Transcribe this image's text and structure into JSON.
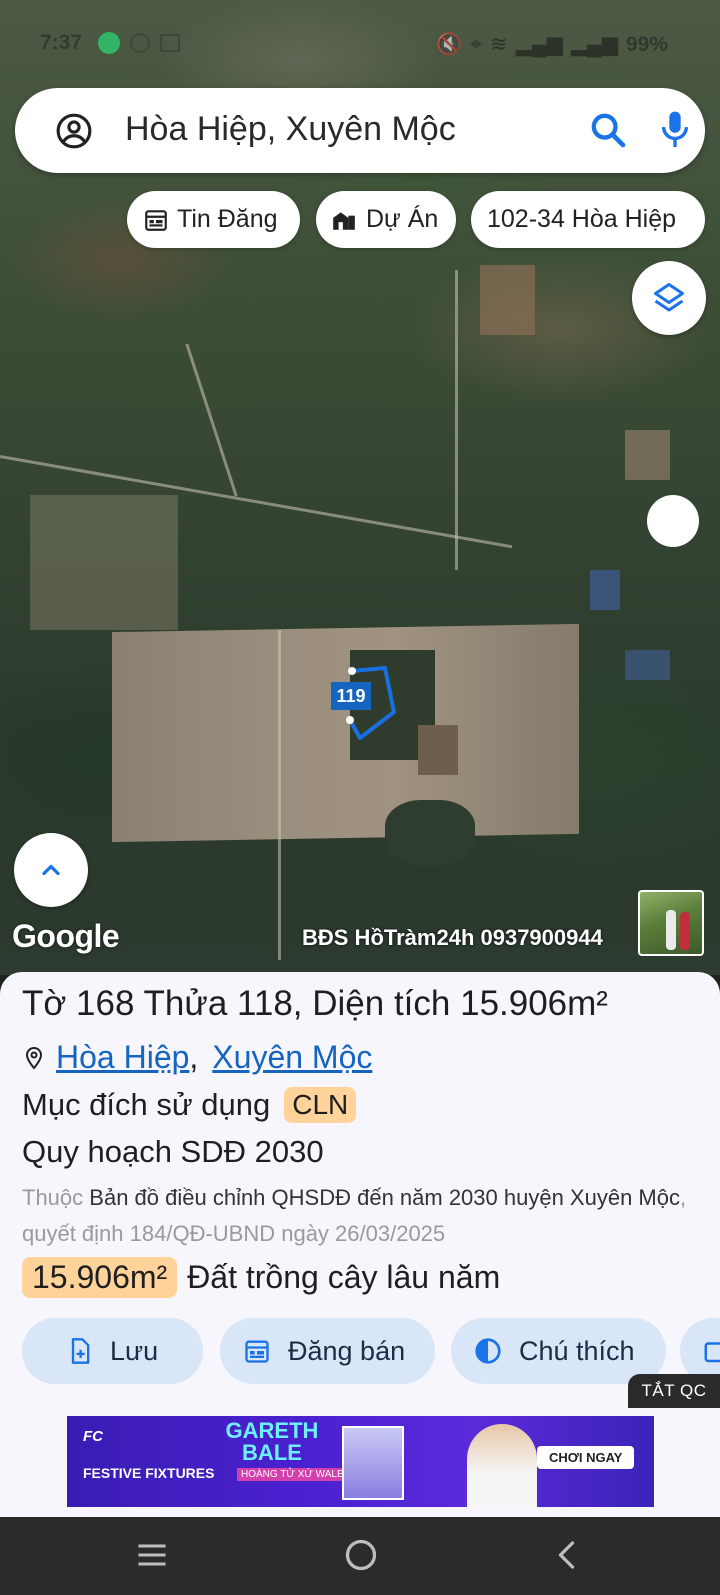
{
  "statusbar": {
    "time": "7:37",
    "battery": "99%"
  },
  "search": {
    "query": "Hòa Hiệp, Xuyên Mộc"
  },
  "chips": [
    {
      "label": "Tin Đăng",
      "icon": "calendar-icon"
    },
    {
      "label": "Dự Án",
      "icon": "building-icon"
    },
    {
      "label": "102-34 Hòa Hiệp"
    }
  ],
  "map": {
    "parcel_number": "119",
    "google_label": "Google",
    "watermark": "BĐS HồTràm24h 0937900944",
    "parcel_color": "#1565c0"
  },
  "panel": {
    "title": "Tờ 168 Thửa 118, Diện tích 15.906m²",
    "location": {
      "ward": "Hòa Hiệp",
      "district": "Xuyên Mộc"
    },
    "purpose_label": "Mục đích sử dụng",
    "purpose_code": "CLN",
    "plan_title": "Quy hoạch SDĐ 2030",
    "desc_prefix": "Thuộc",
    "desc_main": "Bản đồ điều chỉnh QHSDĐ đến năm 2030 huyện Xuyên Mộc",
    "desc_suffix": ", quyết định 184/QĐ-UBND ngày 26/03/2025",
    "area_value": "15.906m²",
    "area_type": "Đất trồng cây lâu năm",
    "badge_color": "#ffd39a"
  },
  "actions": [
    {
      "label": "Lưu",
      "icon": "save-file-icon"
    },
    {
      "label": "Đăng bán",
      "icon": "calendar-icon"
    },
    {
      "label": "Chú thích",
      "icon": "contrast-icon"
    }
  ],
  "ad": {
    "close_label": "TẮT QC",
    "brand_line": "FC",
    "promo_lines": "FESTIVE FIXTURES",
    "player_name": "GARETH BALE",
    "tagline": "HOÀNG TỬ XỨ WALES",
    "cta": "CHƠI NGAY"
  }
}
